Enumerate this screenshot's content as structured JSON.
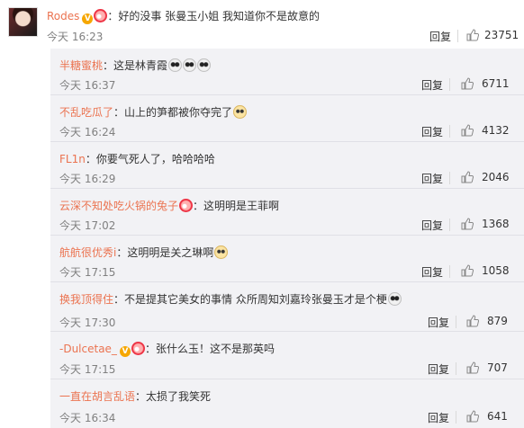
{
  "main_comment": {
    "username": "Rodes",
    "text": "：好的没事 张曼玉小姐 我知道你不是故意的",
    "time": "今天 16:23",
    "reply_label": "回复",
    "likes": "23751"
  },
  "replies": [
    {
      "username": "半糖蜜桃",
      "text": "：这是林青霞",
      "time": "今天 16:37",
      "reply_label": "回复",
      "likes": "6711",
      "emojis": [
        "panda",
        "panda",
        "panda"
      ]
    },
    {
      "username": "不乱吃瓜了",
      "text": "：山上的笋都被你夺完了",
      "time": "今天 16:24",
      "reply_label": "回复",
      "likes": "4132",
      "emojis": [
        "doge"
      ]
    },
    {
      "username": "FL1n",
      "text": "：你要气死人了，哈哈哈哈",
      "time": "今天 16:29",
      "reply_label": "回复",
      "likes": "2046",
      "emojis": []
    },
    {
      "username": "云深不知处吃火锅的兔子",
      "text": "：这明明是王菲啊",
      "time": "今天 17:02",
      "reply_label": "回复",
      "likes": "1368",
      "emojis": []
    },
    {
      "username": "航航很优秀i",
      "text": "：这明明是关之琳啊",
      "time": "今天 17:15",
      "reply_label": "回复",
      "likes": "1058",
      "emojis": [
        "doge"
      ]
    },
    {
      "username": "换我顶得住",
      "text": "：不是提其它美女的事情 众所周知刘嘉玲张曼玉才是个梗",
      "time": "今天 17:30",
      "reply_label": "回复",
      "likes": "879",
      "emojis": [
        "panda"
      ]
    },
    {
      "username": "-Dulcetae_",
      "text": "：张什么玉！这不是那英吗",
      "time": "今天 17:15",
      "reply_label": "回复",
      "likes": "707",
      "emojis": []
    },
    {
      "username": "一直在胡言乱语",
      "text": "：太损了我笑死",
      "time": "今天 16:34",
      "reply_label": "回复",
      "likes": "641",
      "emojis": []
    }
  ],
  "colors": {
    "username": "#eb7350",
    "panel_bg": "#f2f2f5",
    "meta_gray": "#808080"
  }
}
